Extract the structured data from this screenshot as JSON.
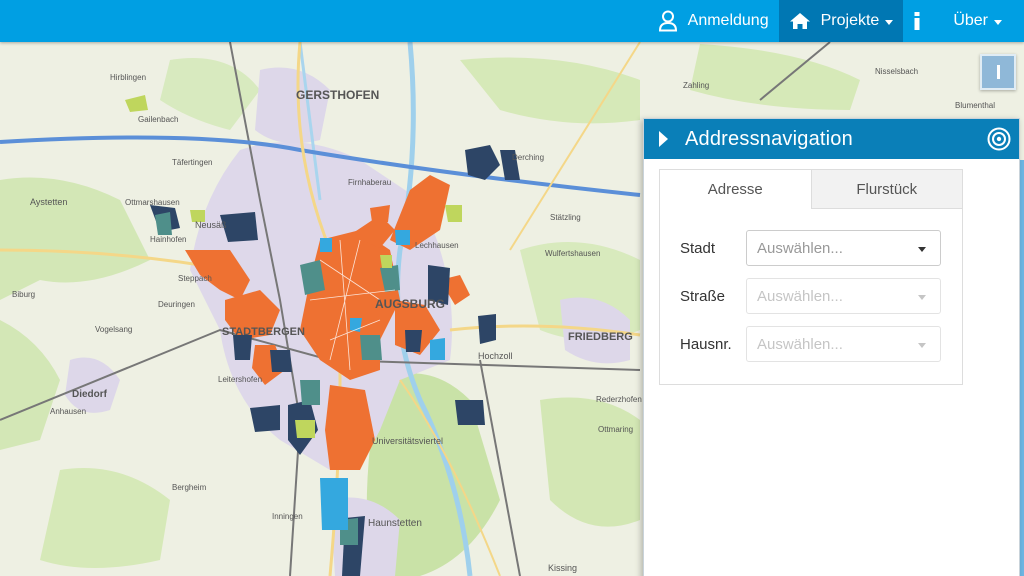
{
  "navbar": {
    "login_label": "Anmeldung",
    "projects_label": "Projekte",
    "about_label": "Über",
    "icons": [
      "user-icon",
      "home-icon",
      "info-icon"
    ]
  },
  "map": {
    "places": [
      "GERSTHOFEN",
      "FRIEDBERG",
      "STADTBERGEN",
      "AUGSBURG",
      "Haunstetten",
      "Diedorf",
      "Aystetten",
      "Kissing",
      "Biburg",
      "Hochzoll",
      "Universitätsviertel",
      "Leitershofen",
      "Bergheim",
      "Inningen",
      "Derching",
      "Stätzling",
      "Firnhaberau",
      "Lechhausen",
      "Neusäß",
      "Steppach",
      "Hainhofen",
      "Deuringen",
      "Ottmarshausen",
      "Vogelsang",
      "Anhausen",
      "Täfertingen",
      "Gailenbach",
      "Hirblingen",
      "Wulfertshausen",
      "Blumenthal",
      "Nisselsbach",
      "Zahling",
      "Rederzhofen",
      "Ottmaring"
    ],
    "colors": {
      "orange": "#ee7132",
      "navy": "#2d4566",
      "teal": "#4f8f8a",
      "lightblue": "#34a8df",
      "lime": "#bfd65d"
    }
  },
  "panel": {
    "title": "Addressnavigation",
    "tabs": [
      {
        "label": "Adresse",
        "active": true
      },
      {
        "label": "Flurstück",
        "active": false
      }
    ],
    "fields": [
      {
        "label": "Stadt",
        "placeholder": "Auswählen...",
        "enabled": true
      },
      {
        "label": "Straße",
        "placeholder": "Auswählen...",
        "enabled": false
      },
      {
        "label": "Hausnr.",
        "placeholder": "Auswählen...",
        "enabled": false
      }
    ]
  }
}
